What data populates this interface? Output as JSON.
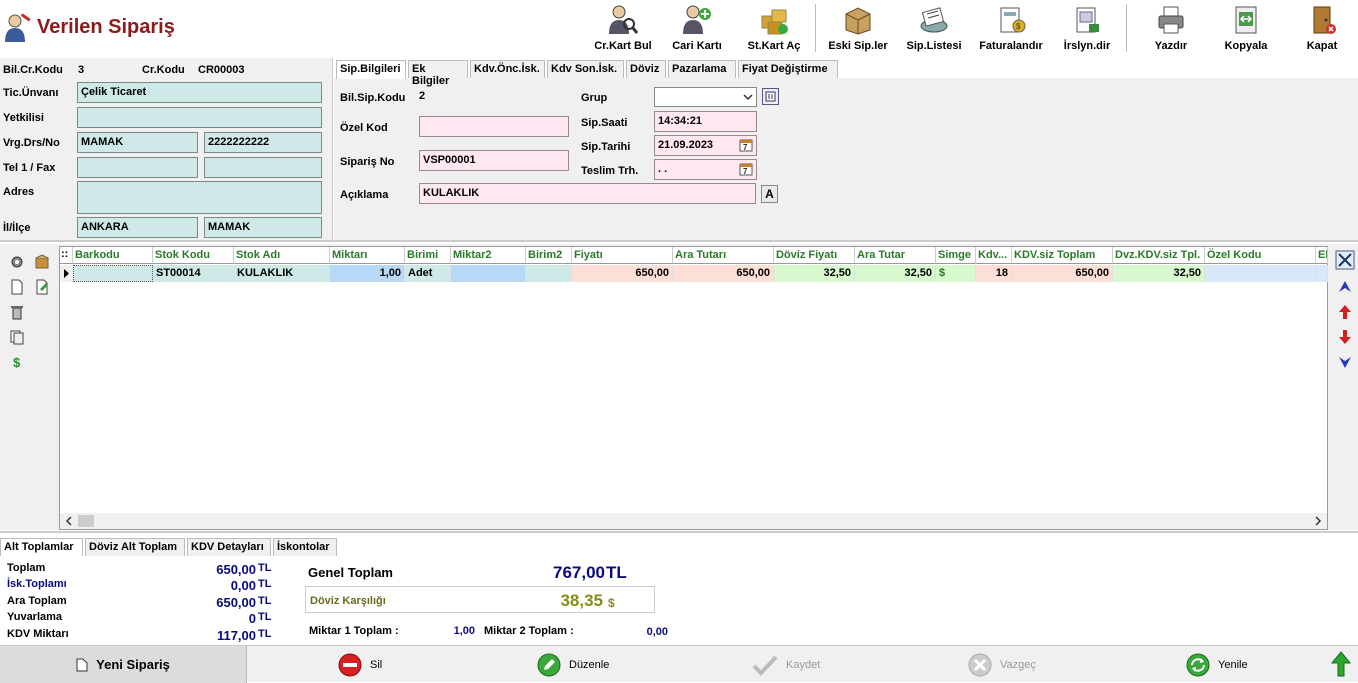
{
  "app": {
    "title": "Verilen Sipariş"
  },
  "toolbar": [
    {
      "label": "Cr.Kart Bul",
      "icon": "customer-search-icon"
    },
    {
      "label": "Cari Kartı",
      "icon": "customer-add-icon"
    },
    {
      "label": "St.Kart Aç",
      "icon": "stock-card-icon"
    },
    {
      "label": "Eski Sip.ler",
      "icon": "old-orders-icon"
    },
    {
      "label": "Sip.Listesi",
      "icon": "order-list-icon"
    },
    {
      "label": "Faturalandır",
      "icon": "invoice-icon"
    },
    {
      "label": "İrslyn.dir",
      "icon": "dispatch-icon"
    },
    {
      "label": "Yazdır",
      "icon": "printer-icon"
    },
    {
      "label": "Kopyala",
      "icon": "copy-icon"
    },
    {
      "label": "Kapat",
      "icon": "exit-door-icon"
    }
  ],
  "customer": {
    "bil_cr_kodu_label": "Bil.Cr.Kodu",
    "bil_cr_kodu": "3",
    "cr_kodu_label": "Cr.Kodu",
    "cr_kodu": "CR00003",
    "unvan_label": "Tic.Ünvanı",
    "unvan": "Çelik Ticaret",
    "yetkili_label": "Yetkilisi",
    "yetkili": "",
    "vergi_label": "Vrg.Drs/No",
    "vergi_dairesi": "MAMAK",
    "vergi_no": "2222222222",
    "tel_label": "Tel 1 / Fax",
    "tel": "",
    "fax": "",
    "adres_label": "Adres",
    "adres": "",
    "il_label": "İl/İlçe",
    "il": "ANKARA",
    "ilce": "MAMAK"
  },
  "order_tabs": [
    "Sip.Bilgileri",
    "Ek Bilgiler",
    "Kdv.Önc.İsk.",
    "Kdv Son.İsk.",
    "Döviz",
    "Pazarlama",
    "Fiyat Değiştirme"
  ],
  "order": {
    "bil_sip_kodu_label": "Bil.Sip.Kodu",
    "bil_sip_kodu": "2",
    "ozel_kod_label": "Özel Kod",
    "ozel_kod": "",
    "siparis_no_label": "Sipariş No",
    "siparis_no": "VSP00001",
    "aciklama_label": "Açıklama",
    "aciklama": "KULAKLIK",
    "grup_label": "Grup",
    "grup": "",
    "sip_saati_label": "Sip.Saati",
    "sip_saati": "14:34:21",
    "sip_tarihi_label": "Sip.Tarihi",
    "sip_tarihi": "21.09.2023",
    "teslim_label": "Teslim Trh.",
    "teslim": " .  .",
    "a_button": "A"
  },
  "grid": {
    "columns": [
      "Barkodu",
      "Stok Kodu",
      "Stok Adı",
      "Miktarı",
      "Birimi",
      "Miktar2",
      "Birim2",
      "Fiyatı",
      "Ara Tutarı",
      "Döviz Fiyatı",
      "Ara Tutar",
      "Simge",
      "Kdv...",
      "KDV.siz Toplam",
      "Dvz.KDV.siz Tpl.",
      "Özel Kodu",
      "Ek"
    ],
    "rows": [
      [
        "",
        "ST00014",
        "KULAKLIK",
        "1,00",
        "Adet",
        "",
        "",
        "650,00",
        "650,00",
        "32,50",
        "32,50",
        "$",
        "18",
        "650,00",
        "32,50",
        "",
        ""
      ]
    ],
    "corner": "::"
  },
  "bottom_tabs": [
    "Alt Toplamlar",
    "Döviz Alt Toplam",
    "KDV Detayları",
    "İskontolar"
  ],
  "totals": {
    "toplam_label": "Toplam",
    "toplam": "650,00",
    "isk_label": "İsk.Toplamı",
    "isk": "0,00",
    "ara_label": "Ara Toplam",
    "ara": "650,00",
    "yuv_label": "Yuvarlama",
    "yuv": "0",
    "kdv_label": "KDV Miktarı",
    "kdv": "117,00",
    "currency": "TL",
    "genel_label": "Genel Toplam",
    "genel": "767,00",
    "genel_currency": "TL",
    "doviz_label": "Döviz Karşılığı",
    "doviz": "38,35",
    "doviz_currency": "$",
    "miktar1_label": "Miktar 1 Toplam :",
    "miktar1": "1,00",
    "miktar2_label": "Miktar 2 Toplam :",
    "miktar2": "0,00"
  },
  "actions": {
    "yeni": "Yeni Sipariş",
    "sil": "Sil",
    "duzenle": "Düzenle",
    "kaydet": "Kaydet",
    "vazgec": "Vazgeç",
    "yenile": "Yenile"
  },
  "colors": {
    "title": "#8b1a1a",
    "field_teal": "#cfe8e8",
    "field_pink": "#ffe8f0",
    "header_green": "#2a7a2a",
    "total_blue": "#0a0a7a",
    "doviz_olive": "#8a8a1a"
  }
}
